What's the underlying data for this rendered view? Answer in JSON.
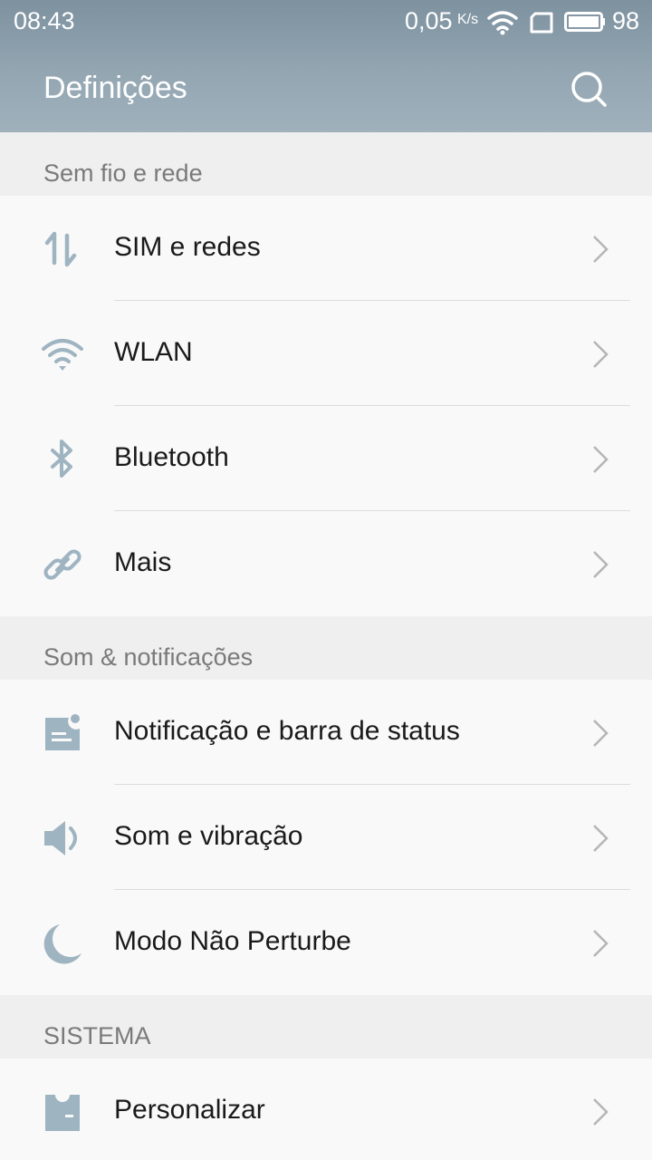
{
  "status_bar": {
    "time": "08:43",
    "speed": "0,05",
    "speed_unit": "K/s",
    "battery": "98"
  },
  "header": {
    "title": "Definições",
    "search_icon": "search-icon"
  },
  "sections": [
    {
      "title": "Sem fio e rede",
      "items": [
        {
          "label": "SIM e redes",
          "icon": "sim-data-arrows-icon"
        },
        {
          "label": "WLAN",
          "icon": "wifi-icon"
        },
        {
          "label": "Bluetooth",
          "icon": "bluetooth-icon"
        },
        {
          "label": "Mais",
          "icon": "link-icon"
        }
      ]
    },
    {
      "title": "Som & notificações",
      "items": [
        {
          "label": "Notificação e barra de status",
          "icon": "notification-icon"
        },
        {
          "label": "Som e vibração",
          "icon": "speaker-icon"
        },
        {
          "label": "Modo Não Perturbe",
          "icon": "moon-icon"
        }
      ]
    },
    {
      "title": "SISTEMA",
      "items": [
        {
          "label": "Personalizar",
          "icon": "personalize-icon"
        }
      ]
    }
  ],
  "colors": {
    "header_bg": "#8fa2ae",
    "icon": "#9fb4c1",
    "chevron": "#b5b5b5"
  }
}
